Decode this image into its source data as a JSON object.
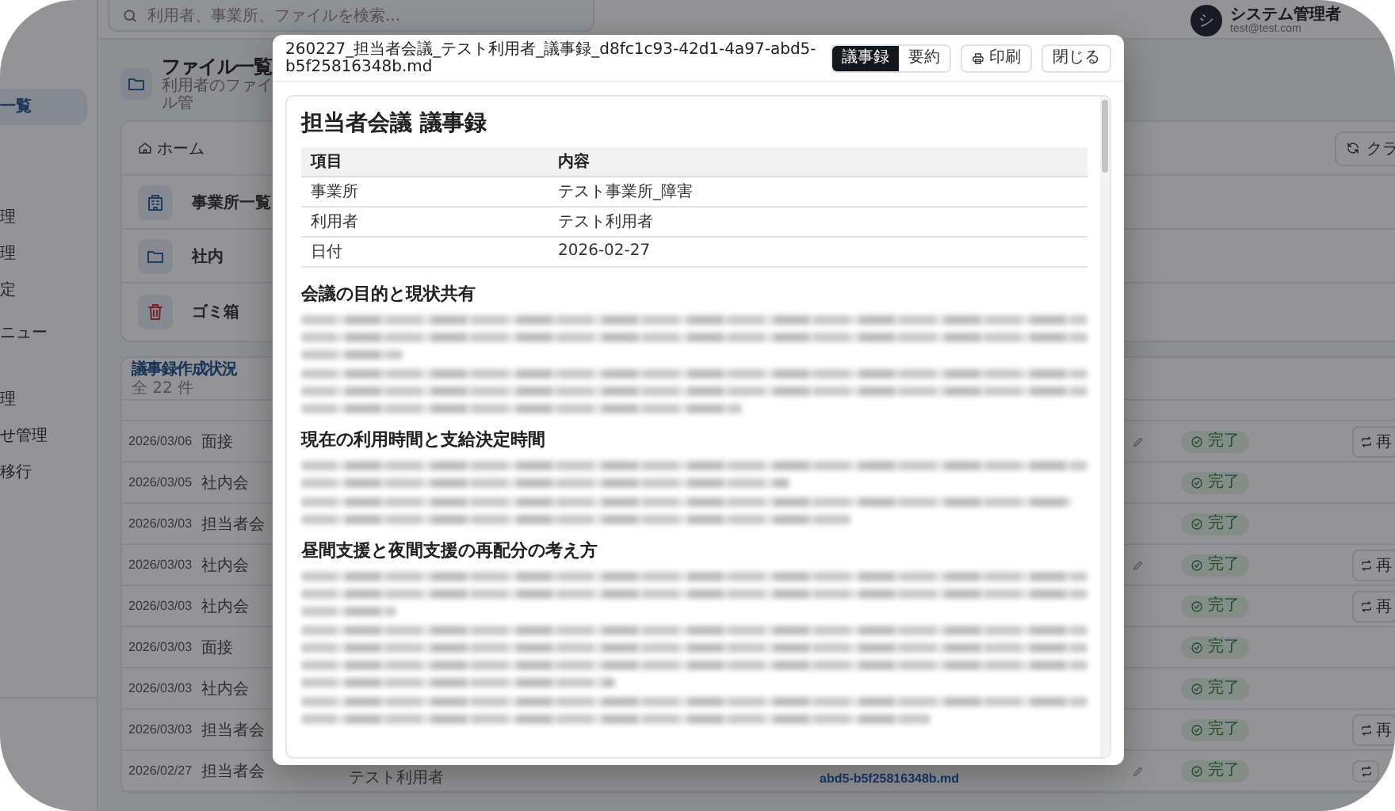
{
  "top_bar": {
    "search": {
      "placeholder": "利用者、事業所、ファイルを検索..."
    },
    "user": {
      "avatar": "シ",
      "name": "システム管理者",
      "email": "test@test.com"
    }
  },
  "sidebar": {
    "groups": [
      {
        "items": [
          {
            "label": "一覧",
            "selected": true
          }
        ]
      },
      {
        "items": [
          {
            "label": "理",
            "selected": false
          },
          {
            "label": "理",
            "selected": false
          },
          {
            "label": "定",
            "selected": false
          }
        ]
      },
      {
        "items": [
          {
            "label": "ニュー",
            "selected": false
          }
        ]
      },
      {
        "items": [
          {
            "label": "理",
            "selected": false
          },
          {
            "label": "せ管理",
            "selected": false
          },
          {
            "label": "移行",
            "selected": false
          }
        ]
      }
    ]
  },
  "page_header": {
    "title": "ファイル一覧",
    "subtitle": "利用者のファイル管"
  },
  "file_browser": {
    "breadcrumb": "ホーム",
    "action_button": "クラ",
    "folders": [
      {
        "name": "事業所一覧",
        "kind": "office"
      },
      {
        "name": "社内",
        "kind": "folder"
      },
      {
        "name": "ゴミ箱",
        "kind": "trash"
      }
    ]
  },
  "minutes_status": {
    "title": "議事録作成状況",
    "count": "全 22 件",
    "rows": [
      {
        "date": "2026/03/06",
        "type": "面接",
        "edit_icon": true,
        "status": "完了",
        "action": "再"
      },
      {
        "date": "2026/03/05",
        "type": "社内会",
        "edit_icon": false,
        "status": "完了"
      },
      {
        "date": "2026/03/03",
        "type": "担当者会",
        "edit_icon": false,
        "status": "完了"
      },
      {
        "date": "2026/03/03",
        "type": "社内会",
        "edit_icon": true,
        "status": "完了",
        "action": "再"
      },
      {
        "date": "2026/03/03",
        "type": "社内会",
        "edit_icon": false,
        "status": "完了",
        "action": "再"
      },
      {
        "date": "2026/03/03",
        "type": "面接",
        "edit_icon": false,
        "status": "完了"
      },
      {
        "date": "2026/03/03",
        "type": "社内会",
        "edit_icon": false,
        "status": "完了"
      },
      {
        "date": "2026/03/03",
        "type": "担当者会",
        "edit_icon": false,
        "status": "完了",
        "action": "再"
      },
      {
        "date": "2026/02/27",
        "type": "担当者会",
        "user": "テスト利用者",
        "file": "abd5-b5f25816348b.md",
        "edit_icon": true,
        "status": "完了",
        "action": ""
      }
    ]
  },
  "modal": {
    "filename": "260227_担当者会議_テスト利用者_議事録_d8fc1c93-42d1-4a97-abd5-b5f25816348b.md",
    "view_tabs": [
      {
        "label": "議事録",
        "selected": true
      },
      {
        "label": "要約",
        "selected": false
      }
    ],
    "print_button": "印刷",
    "close_button": "閉じる",
    "document": {
      "title": "担当者会議 議事録",
      "table": {
        "columns": [
          "項目",
          "内容"
        ],
        "rows": [
          [
            "事業所",
            "テスト事業所_障害"
          ],
          [
            "利用者",
            "テスト利用者"
          ],
          [
            "日付",
            "2026-02-27"
          ]
        ]
      },
      "sections": [
        {
          "heading": "会議の目的と現状共有"
        },
        {
          "heading": "現在の利用時間と支給決定時間"
        },
        {
          "heading": "昼間支援と夜間支援の再配分の考え方"
        }
      ]
    }
  }
}
